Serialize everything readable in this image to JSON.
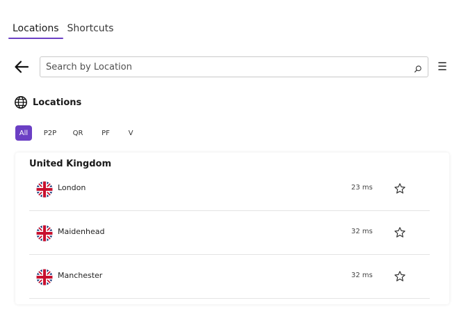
{
  "tabs": [
    {
      "label": "Locations",
      "active": true
    },
    {
      "label": "Shortcuts",
      "active": false
    }
  ],
  "search": {
    "placeholder": "Search by Location",
    "value": ""
  },
  "section": {
    "title": "Locations",
    "icon": "globe-icon"
  },
  "filters": [
    {
      "label": "All",
      "active": true
    },
    {
      "label": "P2P",
      "active": false
    },
    {
      "label": "QR",
      "active": false
    },
    {
      "label": "PF",
      "active": false
    },
    {
      "label": "V",
      "active": false
    }
  ],
  "country": {
    "name": "United Kingdom",
    "locations": [
      {
        "city": "London",
        "latency": "23 ms",
        "flag": "uk-flag-icon"
      },
      {
        "city": "Maidenhead",
        "latency": "32 ms",
        "flag": "uk-flag-icon"
      },
      {
        "city": "Manchester",
        "latency": "32 ms",
        "flag": "uk-flag-icon"
      }
    ]
  },
  "colors": {
    "accent": "#6b3fc4",
    "flag_red": "#c8102e",
    "flag_blue": "#012169"
  }
}
